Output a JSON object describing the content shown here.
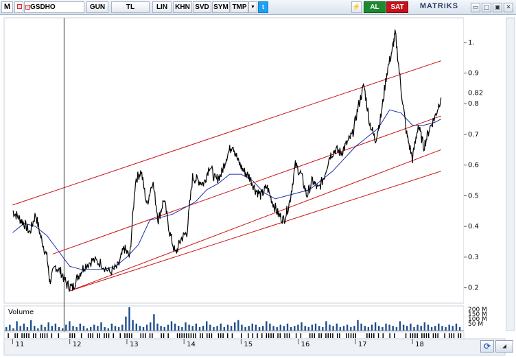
{
  "toolbar": {
    "m_label": "M",
    "symbol": "GSDHO",
    "gun": "GUN",
    "tl": "TL",
    "lin": "LIN",
    "khn": "KHN",
    "svd": "SVD",
    "sym": "SYM",
    "tmp": "TMP",
    "dropdown": "▼",
    "twitter": "t",
    "flash": "⚡",
    "refresh": "↻",
    "buy": "AL",
    "sell": "SAT",
    "logo": "MATRiKS",
    "win_min": "▭",
    "win_restore": "□",
    "win_max": "▣",
    "win_close": "✕"
  },
  "chart_data": {
    "type": "line",
    "symbol": "GSDHO",
    "x_ticks": [
      "11",
      "12",
      "13",
      "14",
      "15",
      "16",
      "17",
      "18"
    ],
    "y_ticks": [
      0.2,
      0.3,
      0.4,
      0.5,
      0.6,
      0.7,
      0.8,
      0.9,
      1.0
    ],
    "y_tick_labels": [
      "0.2",
      "0.3",
      "0.4",
      "0.5",
      "0.6",
      "0.7",
      "0.8",
      "0.9",
      "1."
    ],
    "ylim": [
      0.15,
      1.08
    ],
    "last_price_label": "0.82",
    "last_price": 0.82,
    "volume_label": "Volume",
    "volume_ticks": [
      "200 M",
      "150 M",
      "100 M",
      "50 M"
    ],
    "colors": {
      "price": "#000000",
      "ma": "#1a2ea8",
      "channel": "#cc1111",
      "volume": "#1f4e8c",
      "cursor": "#444444"
    },
    "price_path": [
      [
        11.0,
        0.45
      ],
      [
        11.1,
        0.43
      ],
      [
        11.2,
        0.41
      ],
      [
        11.3,
        0.38
      ],
      [
        11.4,
        0.44
      ],
      [
        11.5,
        0.36
      ],
      [
        11.6,
        0.3
      ],
      [
        11.65,
        0.22
      ],
      [
        11.75,
        0.27
      ],
      [
        11.85,
        0.25
      ],
      [
        11.95,
        0.21
      ],
      [
        12.05,
        0.2
      ],
      [
        12.15,
        0.24
      ],
      [
        12.25,
        0.27
      ],
      [
        12.4,
        0.29
      ],
      [
        12.55,
        0.28
      ],
      [
        12.7,
        0.25
      ],
      [
        12.85,
        0.27
      ],
      [
        12.95,
        0.33
      ],
      [
        13.05,
        0.3
      ],
      [
        13.15,
        0.55
      ],
      [
        13.25,
        0.58
      ],
      [
        13.35,
        0.47
      ],
      [
        13.45,
        0.55
      ],
      [
        13.55,
        0.42
      ],
      [
        13.65,
        0.49
      ],
      [
        13.75,
        0.38
      ],
      [
        13.85,
        0.31
      ],
      [
        13.95,
        0.36
      ],
      [
        14.05,
        0.38
      ],
      [
        14.15,
        0.56
      ],
      [
        14.25,
        0.55
      ],
      [
        14.35,
        0.54
      ],
      [
        14.45,
        0.6
      ],
      [
        14.55,
        0.55
      ],
      [
        14.65,
        0.57
      ],
      [
        14.75,
        0.63
      ],
      [
        14.85,
        0.67
      ],
      [
        14.95,
        0.61
      ],
      [
        15.05,
        0.58
      ],
      [
        15.15,
        0.56
      ],
      [
        15.25,
        0.52
      ],
      [
        15.35,
        0.5
      ],
      [
        15.45,
        0.53
      ],
      [
        15.55,
        0.48
      ],
      [
        15.65,
        0.44
      ],
      [
        15.75,
        0.42
      ],
      [
        15.85,
        0.48
      ],
      [
        15.95,
        0.6
      ],
      [
        16.05,
        0.57
      ],
      [
        16.15,
        0.5
      ],
      [
        16.25,
        0.55
      ],
      [
        16.35,
        0.52
      ],
      [
        16.45,
        0.56
      ],
      [
        16.55,
        0.63
      ],
      [
        16.65,
        0.65
      ],
      [
        16.75,
        0.64
      ],
      [
        16.85,
        0.67
      ],
      [
        16.95,
        0.7
      ],
      [
        17.05,
        0.79
      ],
      [
        17.15,
        0.86
      ],
      [
        17.25,
        0.74
      ],
      [
        17.35,
        0.68
      ],
      [
        17.45,
        0.76
      ],
      [
        17.55,
        0.9
      ],
      [
        17.65,
        0.98
      ],
      [
        17.7,
        1.03
      ],
      [
        17.8,
        0.85
      ],
      [
        17.9,
        0.7
      ],
      [
        18.0,
        0.62
      ],
      [
        18.1,
        0.73
      ],
      [
        18.2,
        0.66
      ],
      [
        18.3,
        0.72
      ],
      [
        18.4,
        0.76
      ],
      [
        18.5,
        0.82
      ]
    ],
    "ma_path": [
      [
        11.0,
        0.38
      ],
      [
        11.2,
        0.41
      ],
      [
        11.4,
        0.4
      ],
      [
        11.6,
        0.37
      ],
      [
        11.8,
        0.32
      ],
      [
        12.0,
        0.27
      ],
      [
        12.2,
        0.26
      ],
      [
        12.4,
        0.26
      ],
      [
        12.6,
        0.26
      ],
      [
        12.8,
        0.27
      ],
      [
        13.0,
        0.3
      ],
      [
        13.2,
        0.34
      ],
      [
        13.4,
        0.42
      ],
      [
        13.6,
        0.43
      ],
      [
        13.8,
        0.44
      ],
      [
        14.0,
        0.46
      ],
      [
        14.2,
        0.48
      ],
      [
        14.4,
        0.52
      ],
      [
        14.6,
        0.54
      ],
      [
        14.8,
        0.57
      ],
      [
        15.0,
        0.57
      ],
      [
        15.2,
        0.55
      ],
      [
        15.4,
        0.51
      ],
      [
        15.6,
        0.49
      ],
      [
        15.8,
        0.5
      ],
      [
        16.0,
        0.51
      ],
      [
        16.2,
        0.52
      ],
      [
        16.4,
        0.55
      ],
      [
        16.6,
        0.58
      ],
      [
        16.8,
        0.62
      ],
      [
        17.0,
        0.66
      ],
      [
        17.2,
        0.69
      ],
      [
        17.4,
        0.72
      ],
      [
        17.6,
        0.78
      ],
      [
        17.8,
        0.77
      ],
      [
        18.0,
        0.73
      ],
      [
        18.2,
        0.73
      ],
      [
        18.4,
        0.74
      ],
      [
        18.5,
        0.75
      ]
    ],
    "channels": [
      {
        "from": [
          11.0,
          0.47
        ],
        "to": [
          18.5,
          0.94
        ]
      },
      {
        "from": [
          11.7,
          0.31
        ],
        "to": [
          18.5,
          0.76
        ]
      },
      {
        "from": [
          12.0,
          0.19
        ],
        "to": [
          18.5,
          0.58
        ]
      },
      {
        "from": [
          12.0,
          0.19
        ],
        "to": [
          18.5,
          0.65
        ]
      }
    ],
    "cursor_x": 11.9,
    "volume": [
      3,
      5,
      2,
      8,
      4,
      6,
      3,
      9,
      4,
      2,
      5,
      3,
      7,
      4,
      6,
      3,
      2,
      5,
      8,
      4,
      3,
      6,
      4,
      2,
      3,
      5,
      4,
      7,
      3,
      2,
      6,
      4,
      3,
      5,
      12,
      20,
      9,
      6,
      4,
      3,
      5,
      7,
      14,
      6,
      4,
      3,
      5,
      8,
      6,
      4,
      3,
      7,
      5,
      4,
      6,
      3,
      4,
      8,
      5,
      3,
      4,
      6,
      3,
      5,
      4,
      7,
      9,
      5,
      3,
      4,
      6,
      5,
      3,
      4,
      8,
      6,
      4,
      3,
      5,
      4,
      6,
      3,
      4,
      5,
      7,
      4,
      3,
      5,
      6,
      4,
      3,
      8,
      5,
      4,
      6,
      3,
      4,
      5,
      3,
      4,
      9,
      6,
      4,
      3,
      5,
      7,
      4,
      3,
      6,
      5,
      4,
      3,
      8,
      5,
      4,
      6,
      3,
      5,
      4,
      7,
      5,
      3,
      4,
      6,
      4,
      3,
      5,
      4,
      6,
      3
    ]
  }
}
